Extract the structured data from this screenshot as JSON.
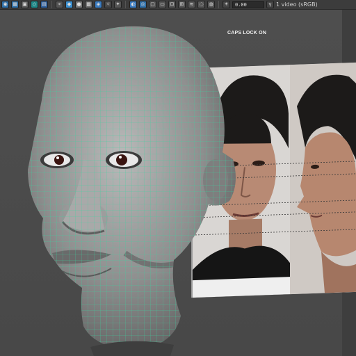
{
  "toolbar": {
    "value_field": "0.00",
    "colorspace_label": "1 video (sRGB)",
    "icons": [
      "camera-icon",
      "grid-icon",
      "cube-icon",
      "wireframe-icon",
      "shaded-icon",
      "lights-icon",
      "textures-icon",
      "shadows-icon",
      "isolate-icon",
      "xray-icon",
      "gamma-icon",
      "exposure-icon"
    ]
  },
  "viewport": {
    "status_text": "CAPS LOCK ON"
  },
  "colors": {
    "wireframe": "#39d4a0",
    "background": "#4b4b4b",
    "toolbar": "#3c3c3c"
  }
}
